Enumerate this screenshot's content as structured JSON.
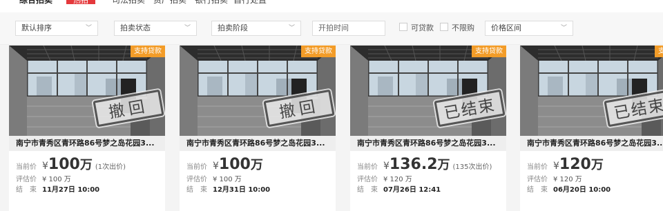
{
  "top_tabs": [
    {
      "label": "综合拍卖"
    },
    {
      "label": "热拍"
    },
    {
      "label": "司法拍卖"
    },
    {
      "label": "资产拍卖"
    },
    {
      "label": "银行拍卖"
    },
    {
      "label": "自行处置"
    }
  ],
  "filters": {
    "sort": "默认排序",
    "status": "拍卖状态",
    "stage": "拍卖阶段",
    "start_time_placeholder": "开拍时间",
    "loan_label": "可贷款",
    "no_limit_label": "不限购",
    "price_range": "价格区间"
  },
  "cards": [
    {
      "badge": "支持贷款",
      "stamp": "撤回",
      "title": "南宁市青秀区青环路86号梦之岛花园3...",
      "price_label": "当前价",
      "currency": "¥",
      "price": "100",
      "price_unit": "万",
      "bids": "(1次出价)",
      "eval_label": "评估价",
      "eval": "¥ 100 万",
      "end_label": "结　束",
      "end_time": "11月27日 10:00"
    },
    {
      "badge": "支持贷款",
      "stamp": "撤回",
      "title": "南宁市青秀区青环路86号梦之岛花园3...",
      "price_label": "当前价",
      "currency": "¥",
      "price": "100",
      "price_unit": "万",
      "bids": "",
      "eval_label": "评估价",
      "eval": "¥ 100 万",
      "end_label": "结　束",
      "end_time": "12月31日 10:00"
    },
    {
      "badge": "支持贷款",
      "stamp": "已结束",
      "title": "南宁市青秀区青环路86号梦之岛花园3...",
      "price_label": "当前价",
      "currency": "¥",
      "price": "136.2",
      "price_unit": "万",
      "bids": "(135次出价)",
      "eval_label": "评估价",
      "eval": "¥ 120 万",
      "end_label": "结　束",
      "end_time": "07月26日 12:41"
    },
    {
      "badge": "支持贷款",
      "stamp": "已结束",
      "title": "南宁市青秀区青环路86号梦之岛花园3...",
      "price_label": "当前价",
      "currency": "¥",
      "price": "120",
      "price_unit": "万",
      "bids": "",
      "eval_label": "评估价",
      "eval": "¥ 120 万",
      "end_label": "结　束",
      "end_time": "06月20日 10:00"
    }
  ],
  "colors": {
    "badge": "#f39c28",
    "hot": "#e4393c"
  }
}
